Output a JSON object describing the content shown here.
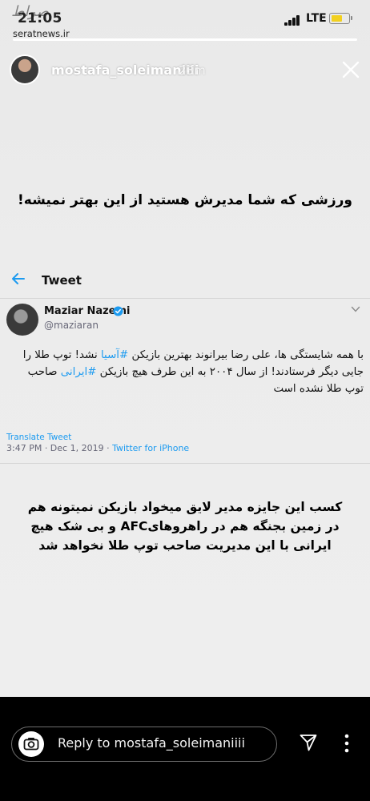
{
  "status_bar": {
    "time": "21:05",
    "network": "LTE",
    "battery_color": "#f2d01f"
  },
  "watermark": {
    "logo_text": "صراط",
    "site": "seratnews.ir"
  },
  "story": {
    "progress": 1.0,
    "username": "mostafa_soleimaniiii",
    "time_ago": "23m",
    "caption_top": "ورزشی که شما مدیرش هستید از این بهتر نمیشه!",
    "caption_bottom": "کسب این جایزه مدیر لایق میخواد بازیکن نمیتونه هم در زمین بجنگه هم در راهروهایAFC و بی شک هیچ ایرانی با این مدیریت صاحب توپ طلا نخواهد شد"
  },
  "tweet": {
    "header_title": "Tweet",
    "author_name": "Maziar Nazemi",
    "author_handle": "@maziaran",
    "body_part1": "با همه شایستگی ها، علی رضا بیرانوند بهترین بازیکن ",
    "hashtag1": "#آسیا",
    "body_part2": " نشد! توپ طلا را جایی دیگر  فرستادند! از سال ۲۰۰۴ به این طرف هیچ بازیکن ",
    "hashtag2": "#ایرانی",
    "body_part3": " صاحب توپ طلا نشده است",
    "translate_label": "Translate Tweet",
    "timestamp": "3:47 PM · Dec 1, 2019 · ",
    "source": "Twitter for iPhone",
    "link_color": "#1d9bf0"
  },
  "reply_bar": {
    "placeholder": "Reply to mostafa_soleimaniiii"
  },
  "icons": [
    "signal-icon",
    "battery-icon",
    "close-icon",
    "back-arrow-icon",
    "verified-badge-icon",
    "chevron-down-icon",
    "camera-icon",
    "send-icon",
    "more-options-icon"
  ]
}
